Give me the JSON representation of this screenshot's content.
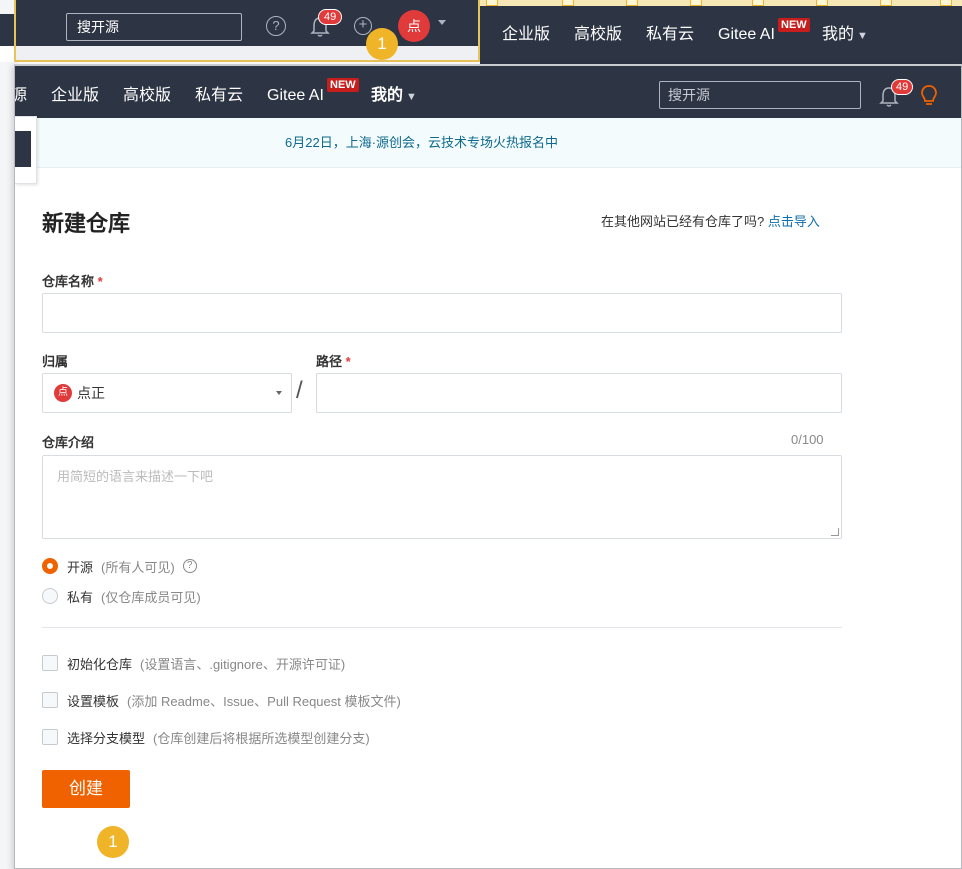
{
  "mini_window": {
    "search_placeholder": "搜开源",
    "help_glyph": "?",
    "notification_count": "49",
    "plus_glyph": "+",
    "avatar_text": "点",
    "hint_badge": "1"
  },
  "background_nav": {
    "items": [
      "企业版",
      "高校版",
      "私有云",
      "Gitee AI",
      "我的"
    ],
    "new_badge": "NEW"
  },
  "header": {
    "nav_items": [
      "源",
      "企业版",
      "高校版",
      "私有云",
      "Gitee AI",
      "我的"
    ],
    "new_badge": "NEW",
    "search_placeholder": "搜开源",
    "notification_count": "49"
  },
  "announcement": "6月22日，上海·源创会，云技术专场火热报名中",
  "form": {
    "title": "新建仓库",
    "import_prompt": "在其他网站已经有仓库了吗?",
    "import_link": "点击导入",
    "repo_name_label": "仓库名称",
    "required_mark": "*",
    "repo_name_value": "",
    "owner_label": "归属",
    "owner_avatar_text": "点",
    "owner_value": "点正",
    "path_separator": "/",
    "path_label": "路径",
    "path_value": "",
    "description_label": "仓库介绍",
    "description_count": "0/100",
    "description_placeholder": "用简短的语言来描述一下吧",
    "visibility": [
      {
        "label": "开源",
        "hint": "(所有人可见)",
        "selected": true
      },
      {
        "label": "私有",
        "hint": "(仅仓库成员可见)",
        "selected": false
      }
    ],
    "help_glyph": "?",
    "options": [
      {
        "label": "初始化仓库",
        "hint": "(设置语言、.gitignore、开源许可证)",
        "checked": false
      },
      {
        "label": "设置模板",
        "hint": "(添加 Readme、Issue、Pull Request 模板文件)",
        "checked": false
      },
      {
        "label": "选择分支模型",
        "hint": "(仓库创建后将根据所选模型创建分支)",
        "checked": false
      }
    ],
    "submit_label": "创建",
    "hint_badge": "1"
  },
  "colors": {
    "nav_bg": "#2d3443",
    "accent": "#f06100",
    "badge": "#e03a3a",
    "link": "#0d6fab",
    "hint": "#f0b429"
  }
}
